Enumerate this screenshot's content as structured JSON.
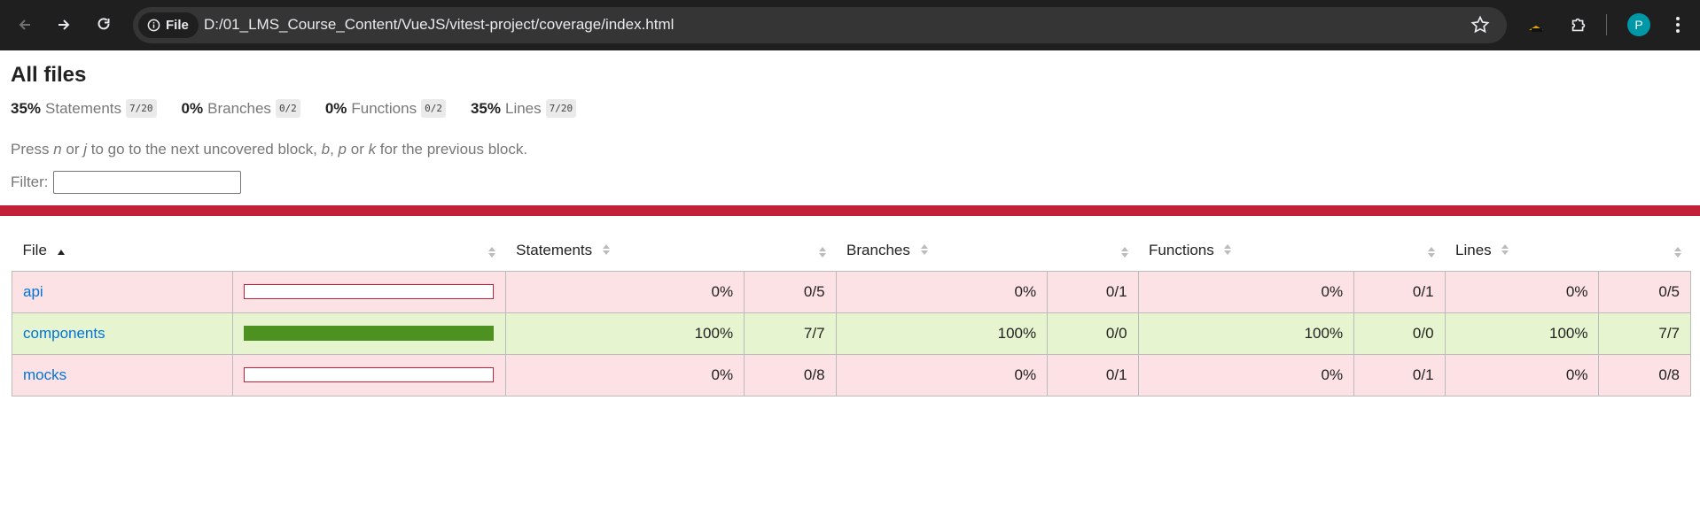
{
  "browser": {
    "chip_label": "File",
    "url": "D:/01_LMS_Course_Content/VueJS/vitest-project/coverage/index.html",
    "profile_initial": "P"
  },
  "report": {
    "title": "All files",
    "summary": [
      {
        "pct": "35%",
        "label": "Statements",
        "fraction": "7/20"
      },
      {
        "pct": "0%",
        "label": "Branches",
        "fraction": "0/2"
      },
      {
        "pct": "0%",
        "label": "Functions",
        "fraction": "0/2"
      },
      {
        "pct": "35%",
        "label": "Lines",
        "fraction": "7/20"
      }
    ],
    "hint": {
      "p1": "Press ",
      "k1": "n",
      "p2": " or ",
      "k2": "j",
      "p3": " to go to the next uncovered block, ",
      "k3": "b",
      "p4": ", ",
      "k4": "p",
      "p5": " or ",
      "k5": "k",
      "p6": " for the previous block."
    },
    "filter_label": "Filter:",
    "filter_value": ""
  },
  "table": {
    "headers": [
      "File",
      "Statements",
      "Branches",
      "Functions",
      "Lines"
    ],
    "rows": [
      {
        "file": "api",
        "status": "low",
        "coverage": 0,
        "stmt_pct": "0%",
        "stmt_frac": "0/5",
        "br_pct": "0%",
        "br_frac": "0/1",
        "fn_pct": "0%",
        "fn_frac": "0/1",
        "ln_pct": "0%",
        "ln_frac": "0/5"
      },
      {
        "file": "components",
        "status": "high",
        "coverage": 1,
        "stmt_pct": "100%",
        "stmt_frac": "7/7",
        "br_pct": "100%",
        "br_frac": "0/0",
        "fn_pct": "100%",
        "fn_frac": "0/0",
        "ln_pct": "100%",
        "ln_frac": "7/7"
      },
      {
        "file": "mocks",
        "status": "low",
        "coverage": 0,
        "stmt_pct": "0%",
        "stmt_frac": "0/8",
        "br_pct": "0%",
        "br_frac": "0/1",
        "fn_pct": "0%",
        "fn_frac": "0/1",
        "ln_pct": "0%",
        "ln_frac": "0/8"
      }
    ]
  },
  "colors": {
    "low_row": "#fce1e5",
    "high_row": "#e6f5d0",
    "status_line": "#c21f39",
    "bar_fill": "#4d9221",
    "link": "#0074d9"
  }
}
